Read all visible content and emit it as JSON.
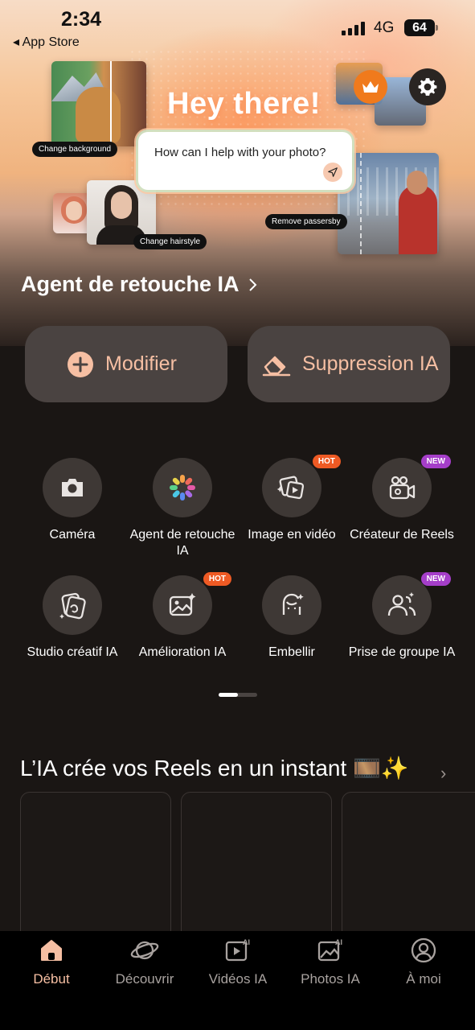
{
  "status_bar": {
    "time": "2:34",
    "back_label": "◂ App Store",
    "network": "4G",
    "battery": "64"
  },
  "hero": {
    "greeting": "Hey there!",
    "prompt_text": "How can I help with your photo?",
    "tags": {
      "change_background": "Change background",
      "change_hairstyle": "Change hairstyle",
      "remove_passersby": "Remove passersby"
    },
    "icons": [
      "crown-icon",
      "gear-icon",
      "send-icon"
    ]
  },
  "agent": {
    "title": "Agent de retouche IA"
  },
  "primary_actions": {
    "modify": "Modifier",
    "remove": "Suppression IA"
  },
  "tools": [
    {
      "label": "Caméra",
      "icon": "camera-icon",
      "badge": ""
    },
    {
      "label": "Agent de retouche IA",
      "icon": "flower-icon",
      "badge": ""
    },
    {
      "label": "Image en vidéo",
      "icon": "image-to-video-icon",
      "badge": "HOT"
    },
    {
      "label": "Créateur de Reels",
      "icon": "reels-creator-icon",
      "badge": "NEW"
    },
    {
      "label": "Studio créatif IA",
      "icon": "creative-studio-icon",
      "badge": ""
    },
    {
      "label": "Amélioration IA",
      "icon": "enhance-icon",
      "badge": "HOT"
    },
    {
      "label": "Embellir",
      "icon": "beautify-icon",
      "badge": ""
    },
    {
      "label": "Prise de groupe IA",
      "icon": "group-photo-icon",
      "badge": "NEW"
    }
  ],
  "reels": {
    "title": "L’IA crée vos Reels en un instant 🎞️✨",
    "more": "›"
  },
  "tabbar": [
    {
      "label": "Début",
      "icon": "home-icon",
      "active": true
    },
    {
      "label": "Découvrir",
      "icon": "planet-icon",
      "active": false
    },
    {
      "label": "Vidéos IA",
      "icon": "ai-video-icon",
      "active": false
    },
    {
      "label": "Photos IA",
      "icon": "ai-photo-icon",
      "active": false
    },
    {
      "label": "À moi",
      "icon": "profile-icon",
      "active": false
    }
  ],
  "colors": {
    "accent": "#f6bfa3",
    "hot_badge": "#ee5a24",
    "new_badge": "#a53ec9",
    "crown": "#f07a1c",
    "background": "#1a1614"
  }
}
